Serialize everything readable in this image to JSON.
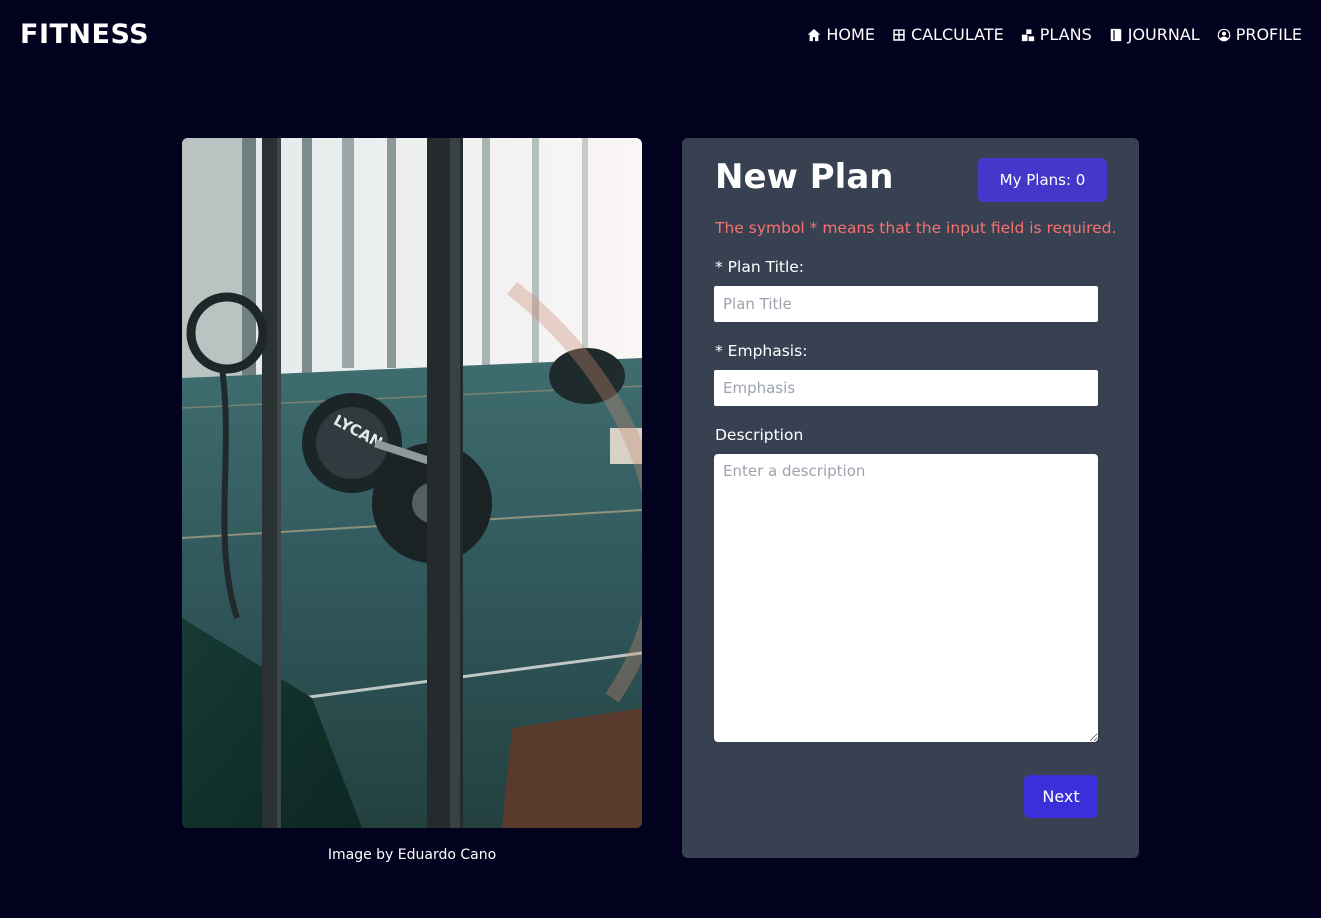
{
  "brand": "FITNESS",
  "nav": [
    {
      "label": "HOME",
      "icon": "home-icon"
    },
    {
      "label": "CALCULATE",
      "icon": "calculator-icon"
    },
    {
      "label": "PLANS",
      "icon": "plans-icon"
    },
    {
      "label": "JOURNAL",
      "icon": "book-icon"
    },
    {
      "label": "PROFILE",
      "icon": "user-circle-icon"
    }
  ],
  "photo": {
    "subject": "gym floor with barbell plates, rings and rope",
    "plate_text": "LYCAN",
    "credit": "Image by Eduardo Cano"
  },
  "form": {
    "title": "New Plan",
    "my_plans_button": "My Plans: 0",
    "required_note": "The symbol * means that the input field is required.",
    "plan_title": {
      "label": "* Plan Title:",
      "placeholder": "Plan Title",
      "value": ""
    },
    "emphasis": {
      "label": "* Emphasis:",
      "placeholder": "Emphasis",
      "value": ""
    },
    "description": {
      "label": "Description",
      "placeholder": "Enter a description",
      "value": ""
    },
    "next_button": "Next"
  },
  "colors": {
    "background": "#03021e",
    "card": "#374151",
    "accent": "#4338ca",
    "next_button": "#3b2fdc",
    "warning_text": "#f87171"
  }
}
